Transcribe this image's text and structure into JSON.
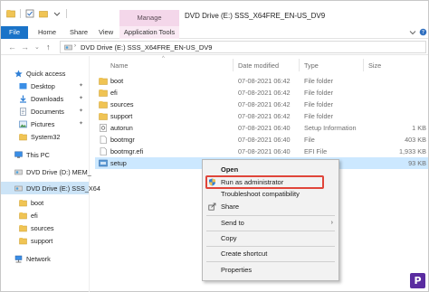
{
  "window": {
    "title": "DVD Drive (E:) SSS_X64FRE_EN-US_DV9",
    "contextual_tab_group": "Manage"
  },
  "ribbon": {
    "tabs": [
      "File",
      "Home",
      "Share",
      "View"
    ],
    "contextual_tab": "Application Tools"
  },
  "address": {
    "path": "DVD Drive (E:) SSS_X64FRE_EN-US_DV9"
  },
  "sidebar": {
    "items": [
      {
        "label": "Quick access",
        "icon": "star-icon",
        "pinned": false
      },
      {
        "label": "Desktop",
        "icon": "desktop-folder-icon",
        "pinned": true
      },
      {
        "label": "Downloads",
        "icon": "downloads-folder-icon",
        "pinned": true
      },
      {
        "label": "Documents",
        "icon": "documents-folder-icon",
        "pinned": true
      },
      {
        "label": "Pictures",
        "icon": "pictures-folder-icon",
        "pinned": true
      },
      {
        "label": "System32",
        "icon": "folder-icon",
        "pinned": false
      },
      {
        "label": "This PC",
        "icon": "computer-icon",
        "pinned": false
      },
      {
        "label": "DVD Drive (D:) MEM_",
        "icon": "dvd-drive-icon",
        "pinned": false
      },
      {
        "label": "DVD Drive (E:) SSS_X64",
        "icon": "dvd-drive-icon",
        "pinned": false,
        "selected": true
      },
      {
        "label": "boot",
        "icon": "folder-icon",
        "pinned": false
      },
      {
        "label": "efi",
        "icon": "folder-icon",
        "pinned": false
      },
      {
        "label": "sources",
        "icon": "folder-icon",
        "pinned": false
      },
      {
        "label": "support",
        "icon": "folder-icon",
        "pinned": false
      },
      {
        "label": "Network",
        "icon": "network-icon",
        "pinned": false
      }
    ]
  },
  "columns": {
    "name": "Name",
    "date": "Date modified",
    "type": "Type",
    "size": "Size"
  },
  "files": [
    {
      "name": "boot",
      "date": "07-08-2021 06:42",
      "type": "File folder",
      "size": "",
      "icon": "folder-icon"
    },
    {
      "name": "efi",
      "date": "07-08-2021 06:42",
      "type": "File folder",
      "size": "",
      "icon": "folder-icon"
    },
    {
      "name": "sources",
      "date": "07-08-2021 06:42",
      "type": "File folder",
      "size": "",
      "icon": "folder-icon"
    },
    {
      "name": "support",
      "date": "07-08-2021 06:42",
      "type": "File folder",
      "size": "",
      "icon": "folder-icon"
    },
    {
      "name": "autorun",
      "date": "07-08-2021 06:40",
      "type": "Setup Information",
      "size": "1 KB",
      "icon": "settings-file-icon"
    },
    {
      "name": "bootmgr",
      "date": "07-08-2021 06:40",
      "type": "File",
      "size": "403 KB",
      "icon": "file-icon"
    },
    {
      "name": "bootmgr.efi",
      "date": "07-08-2021 06:40",
      "type": "EFI File",
      "size": "1,933 KB",
      "icon": "file-icon"
    },
    {
      "name": "setup",
      "date": "",
      "type": "",
      "size": "93 KB",
      "icon": "setup-app-icon",
      "selected": true
    }
  ],
  "context_menu": {
    "items": [
      {
        "label": "Open",
        "bold": true
      },
      {
        "label": "Run as administrator",
        "icon": "shield-icon",
        "highlighted": true
      },
      {
        "label": "Troubleshoot compatibility"
      },
      {
        "label": "Share",
        "icon": "share-icon"
      },
      {
        "label": "Send to",
        "submenu": true
      },
      {
        "label": "Copy"
      },
      {
        "label": "Create shortcut"
      },
      {
        "label": "Properties"
      }
    ]
  },
  "colors": {
    "file_tab": "#1a73c8",
    "manage_tab": "#f4d7ea",
    "selection": "#cce8ff",
    "highlight_box": "#e0453a",
    "folder": "#f0c454"
  }
}
